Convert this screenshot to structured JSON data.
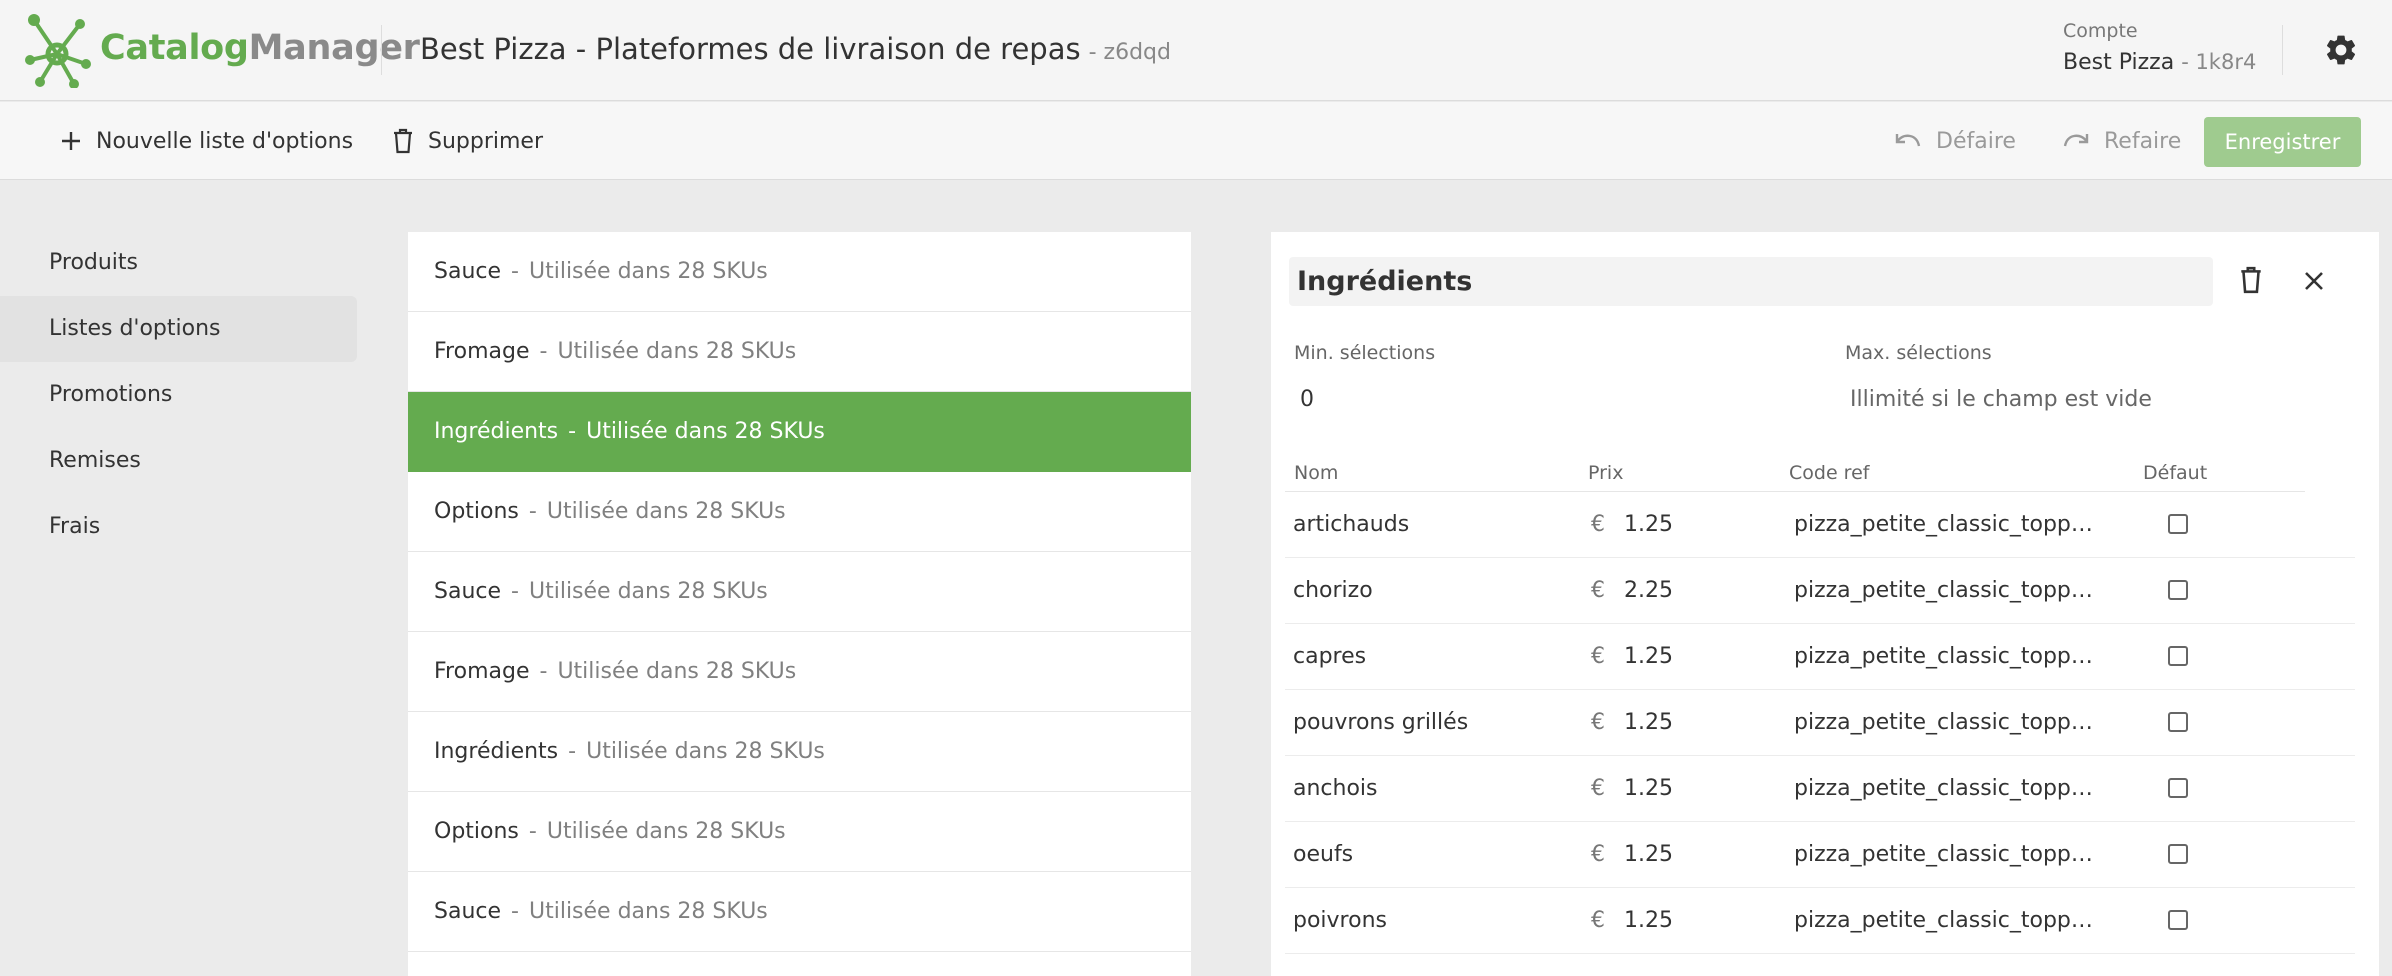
{
  "header": {
    "logo_part1": "Catalog",
    "logo_part2": "Manager",
    "title": "Best Pizza - Plateformes de livraison de repas",
    "title_code": "- z6dqd",
    "account_label": "Compte",
    "account_name": "Best Pizza",
    "account_code": "- 1k8r4",
    "settings_icon": "gear-icon"
  },
  "toolbar": {
    "new_list_label": "Nouvelle liste d'options",
    "delete_label": "Supprimer",
    "undo_label": "Défaire",
    "redo_label": "Refaire",
    "save_label": "Enregistrer"
  },
  "sidebar": {
    "items": [
      {
        "label": "Produits",
        "active": false
      },
      {
        "label": "Listes d'options",
        "active": true
      },
      {
        "label": "Promotions",
        "active": false
      },
      {
        "label": "Remises",
        "active": false
      },
      {
        "label": "Frais",
        "active": false
      }
    ]
  },
  "option_lists": {
    "items": [
      {
        "name": "Sauce",
        "usage": "Utilisée dans 28 SKUs"
      },
      {
        "name": "Fromage",
        "usage": "Utilisée dans 28 SKUs"
      },
      {
        "name": "Ingrédients",
        "usage": "Utilisée dans 28 SKUs"
      },
      {
        "name": "Options",
        "usage": "Utilisée dans 28 SKUs"
      },
      {
        "name": "Sauce",
        "usage": "Utilisée dans 28 SKUs"
      },
      {
        "name": "Fromage",
        "usage": "Utilisée dans 28 SKUs"
      },
      {
        "name": "Ingrédients",
        "usage": "Utilisée dans 28 SKUs"
      },
      {
        "name": "Options",
        "usage": "Utilisée dans 28 SKUs"
      },
      {
        "name": "Sauce",
        "usage": "Utilisée dans 28 SKUs"
      }
    ],
    "active_index": 2,
    "separator": "-"
  },
  "detail": {
    "name": "Ingrédients",
    "min_label": "Min. sélections",
    "min_value": "0",
    "max_label": "Max. sélections",
    "max_placeholder": "Illimité si le champ est vide",
    "columns": {
      "name": "Nom",
      "price": "Prix",
      "ref": "Code ref",
      "default": "Défaut"
    },
    "currency": "€",
    "rows": [
      {
        "name": "artichauds",
        "price": "1.25",
        "ref": "pizza_petite_classic_toppings_artichauds",
        "default": false
      },
      {
        "name": "chorizo",
        "price": "2.25",
        "ref": "pizza_petite_classic_toppings_chorizo",
        "default": false
      },
      {
        "name": "capres",
        "price": "1.25",
        "ref": "pizza_petite_classic_toppings_capres",
        "default": false
      },
      {
        "name": "pouvrons grillés",
        "price": "1.25",
        "ref": "pizza_petite_classic_toppings_pouvrons",
        "default": false
      },
      {
        "name": "anchois",
        "price": "1.25",
        "ref": "pizza_petite_classic_toppings_anchois",
        "default": false
      },
      {
        "name": "oeufs",
        "price": "1.25",
        "ref": "pizza_petite_classic_toppings_oeufs",
        "default": false
      },
      {
        "name": "poivrons",
        "price": "1.25",
        "ref": "pizza_petite_classic_toppings_poivrons",
        "default": false
      }
    ]
  },
  "colors": {
    "brand_green": "#64ab4f",
    "save_disabled": "#9fcb8f",
    "logo_grey": "#8a8a8a"
  }
}
